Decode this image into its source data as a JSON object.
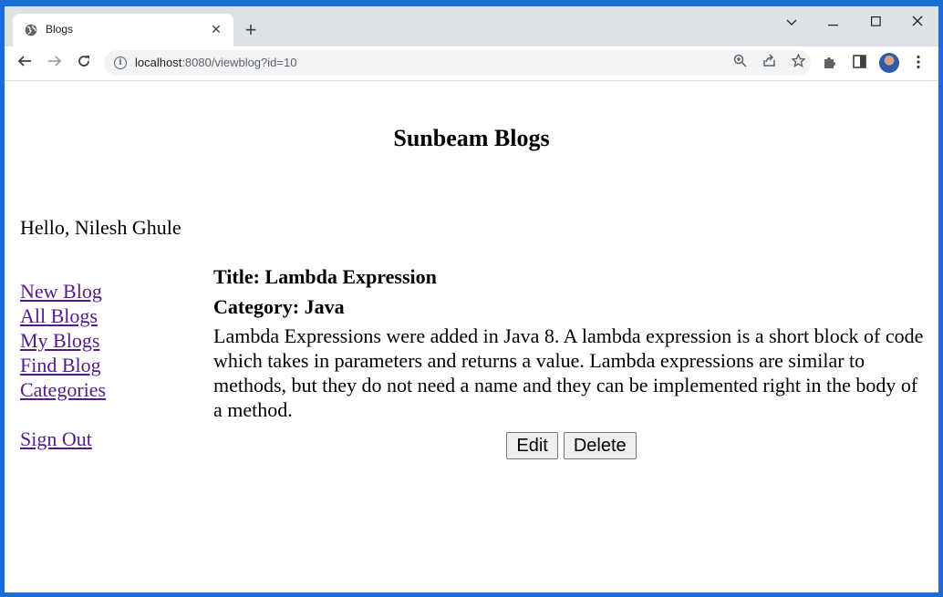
{
  "browser": {
    "tab_title": "Blogs",
    "url_host": "localhost",
    "url_rest": ":8080/viewblog?id=10",
    "tab_close": "✕",
    "new_tab": "+",
    "icons": {
      "favicon": "globe-icon",
      "back": "back-arrow-icon",
      "forward": "forward-arrow-icon",
      "reload": "reload-icon",
      "info": "info-icon",
      "zoom": "zoom-icon",
      "share": "share-icon",
      "bookmark": "star-icon",
      "extensions": "puzzle-icon",
      "side_panel": "side-panel-icon",
      "menu": "kebab-menu-icon"
    }
  },
  "page": {
    "heading": "Sunbeam Blogs",
    "greeting": "Hello, Nilesh Ghule",
    "nav": [
      "New Blog",
      "All Blogs",
      "My Blogs",
      "Find Blog",
      "Categories"
    ],
    "signout": "Sign Out",
    "blog": {
      "title": "Title: Lambda Expression",
      "category": "Category: Java",
      "content": "Lambda Expressions were added in Java 8. A lambda expression is a short block of code which takes in parameters and returns a value. Lambda expressions are similar to methods, but they do not need a name and they can be implemented right in the body of a method."
    },
    "buttons": {
      "edit": "Edit",
      "delete": "Delete"
    }
  },
  "colors": {
    "desktop": "#1b6ed6",
    "tabstrip": "#dee1e6",
    "visited_link": "#551a8b"
  }
}
